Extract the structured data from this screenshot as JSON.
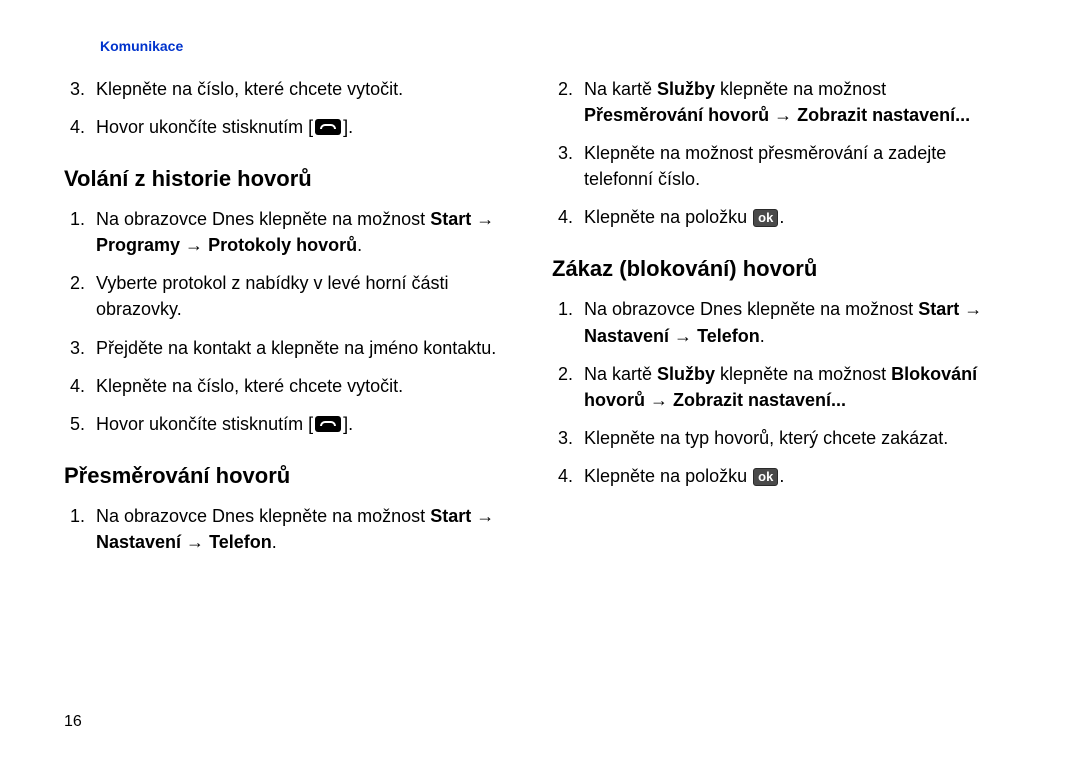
{
  "header": "Komunikace",
  "pageNumber": "16",
  "arrow": " → ",
  "left": {
    "top": {
      "start": 3,
      "items": [
        {
          "kind": "text",
          "text": "Klepněte na číslo, které chcete vytočit."
        },
        {
          "kind": "hangup",
          "before": "Hovor ukončíte stisknutím [",
          "after": "]."
        }
      ]
    },
    "h1": "Volání z historie hovorů",
    "list1": {
      "start": 1,
      "items": [
        {
          "kind": "mix",
          "parts": [
            {
              "t": "Na obrazovce Dnes klepněte na možnost "
            },
            {
              "t": "Start",
              "b": true
            },
            {
              "arrow": true
            },
            {
              "t": "Programy",
              "b": true
            },
            {
              "arrow": true
            },
            {
              "t": "Protokoly hovorů",
              "b": true
            },
            {
              "t": "."
            }
          ]
        },
        {
          "kind": "text",
          "text": "Vyberte protokol z nabídky v levé horní části obrazovky."
        },
        {
          "kind": "text",
          "text": "Přejděte na kontakt a klepněte na jméno kontaktu."
        },
        {
          "kind": "text",
          "text": "Klepněte na číslo, které chcete vytočit."
        },
        {
          "kind": "hangup",
          "before": "Hovor ukončíte stisknutím [",
          "after": "]."
        }
      ]
    },
    "h2": "Přesměrování hovorů",
    "list2": {
      "start": 1,
      "items": [
        {
          "kind": "mix",
          "parts": [
            {
              "t": "Na obrazovce Dnes klepněte na možnost "
            },
            {
              "t": "Start",
              "b": true
            },
            {
              "arrow": true
            },
            {
              "t": "Nastavení",
              "b": true
            },
            {
              "arrow": true
            },
            {
              "t": "Telefon",
              "b": true
            },
            {
              "t": "."
            }
          ]
        }
      ]
    }
  },
  "right": {
    "top": {
      "start": 2,
      "items": [
        {
          "kind": "mix",
          "parts": [
            {
              "t": "Na kartě "
            },
            {
              "t": "Služby",
              "b": true
            },
            {
              "t": " klepněte na možnost "
            },
            {
              "t": "Přesměrování hovorů",
              "b": true
            },
            {
              "arrow": true
            },
            {
              "t": "Zobrazit nastavení...",
              "b": true
            }
          ]
        },
        {
          "kind": "text",
          "text": "Klepněte na možnost přesměrování a zadejte telefonní číslo."
        },
        {
          "kind": "ok",
          "before": "Klepněte na položku ",
          "label": "ok",
          "after": "."
        }
      ]
    },
    "h1": "Zákaz (blokování) hovorů",
    "list1": {
      "start": 1,
      "items": [
        {
          "kind": "mix",
          "parts": [
            {
              "t": "Na obrazovce Dnes klepněte na možnost "
            },
            {
              "t": "Start",
              "b": true
            },
            {
              "arrow": true
            },
            {
              "t": "Nastavení",
              "b": true
            },
            {
              "arrow": true
            },
            {
              "t": "Telefon",
              "b": true
            },
            {
              "t": "."
            }
          ]
        },
        {
          "kind": "mix",
          "parts": [
            {
              "t": "Na kartě "
            },
            {
              "t": "Služby",
              "b": true
            },
            {
              "t": " klepněte na možnost "
            },
            {
              "t": "Blokování hovorů",
              "b": true
            },
            {
              "arrow": true
            },
            {
              "t": "Zobrazit nastavení...",
              "b": true
            }
          ]
        },
        {
          "kind": "text",
          "text": "Klepněte na typ hovorů, který chcete zakázat."
        },
        {
          "kind": "ok",
          "before": "Klepněte na položku ",
          "label": "ok",
          "after": "."
        }
      ]
    }
  }
}
